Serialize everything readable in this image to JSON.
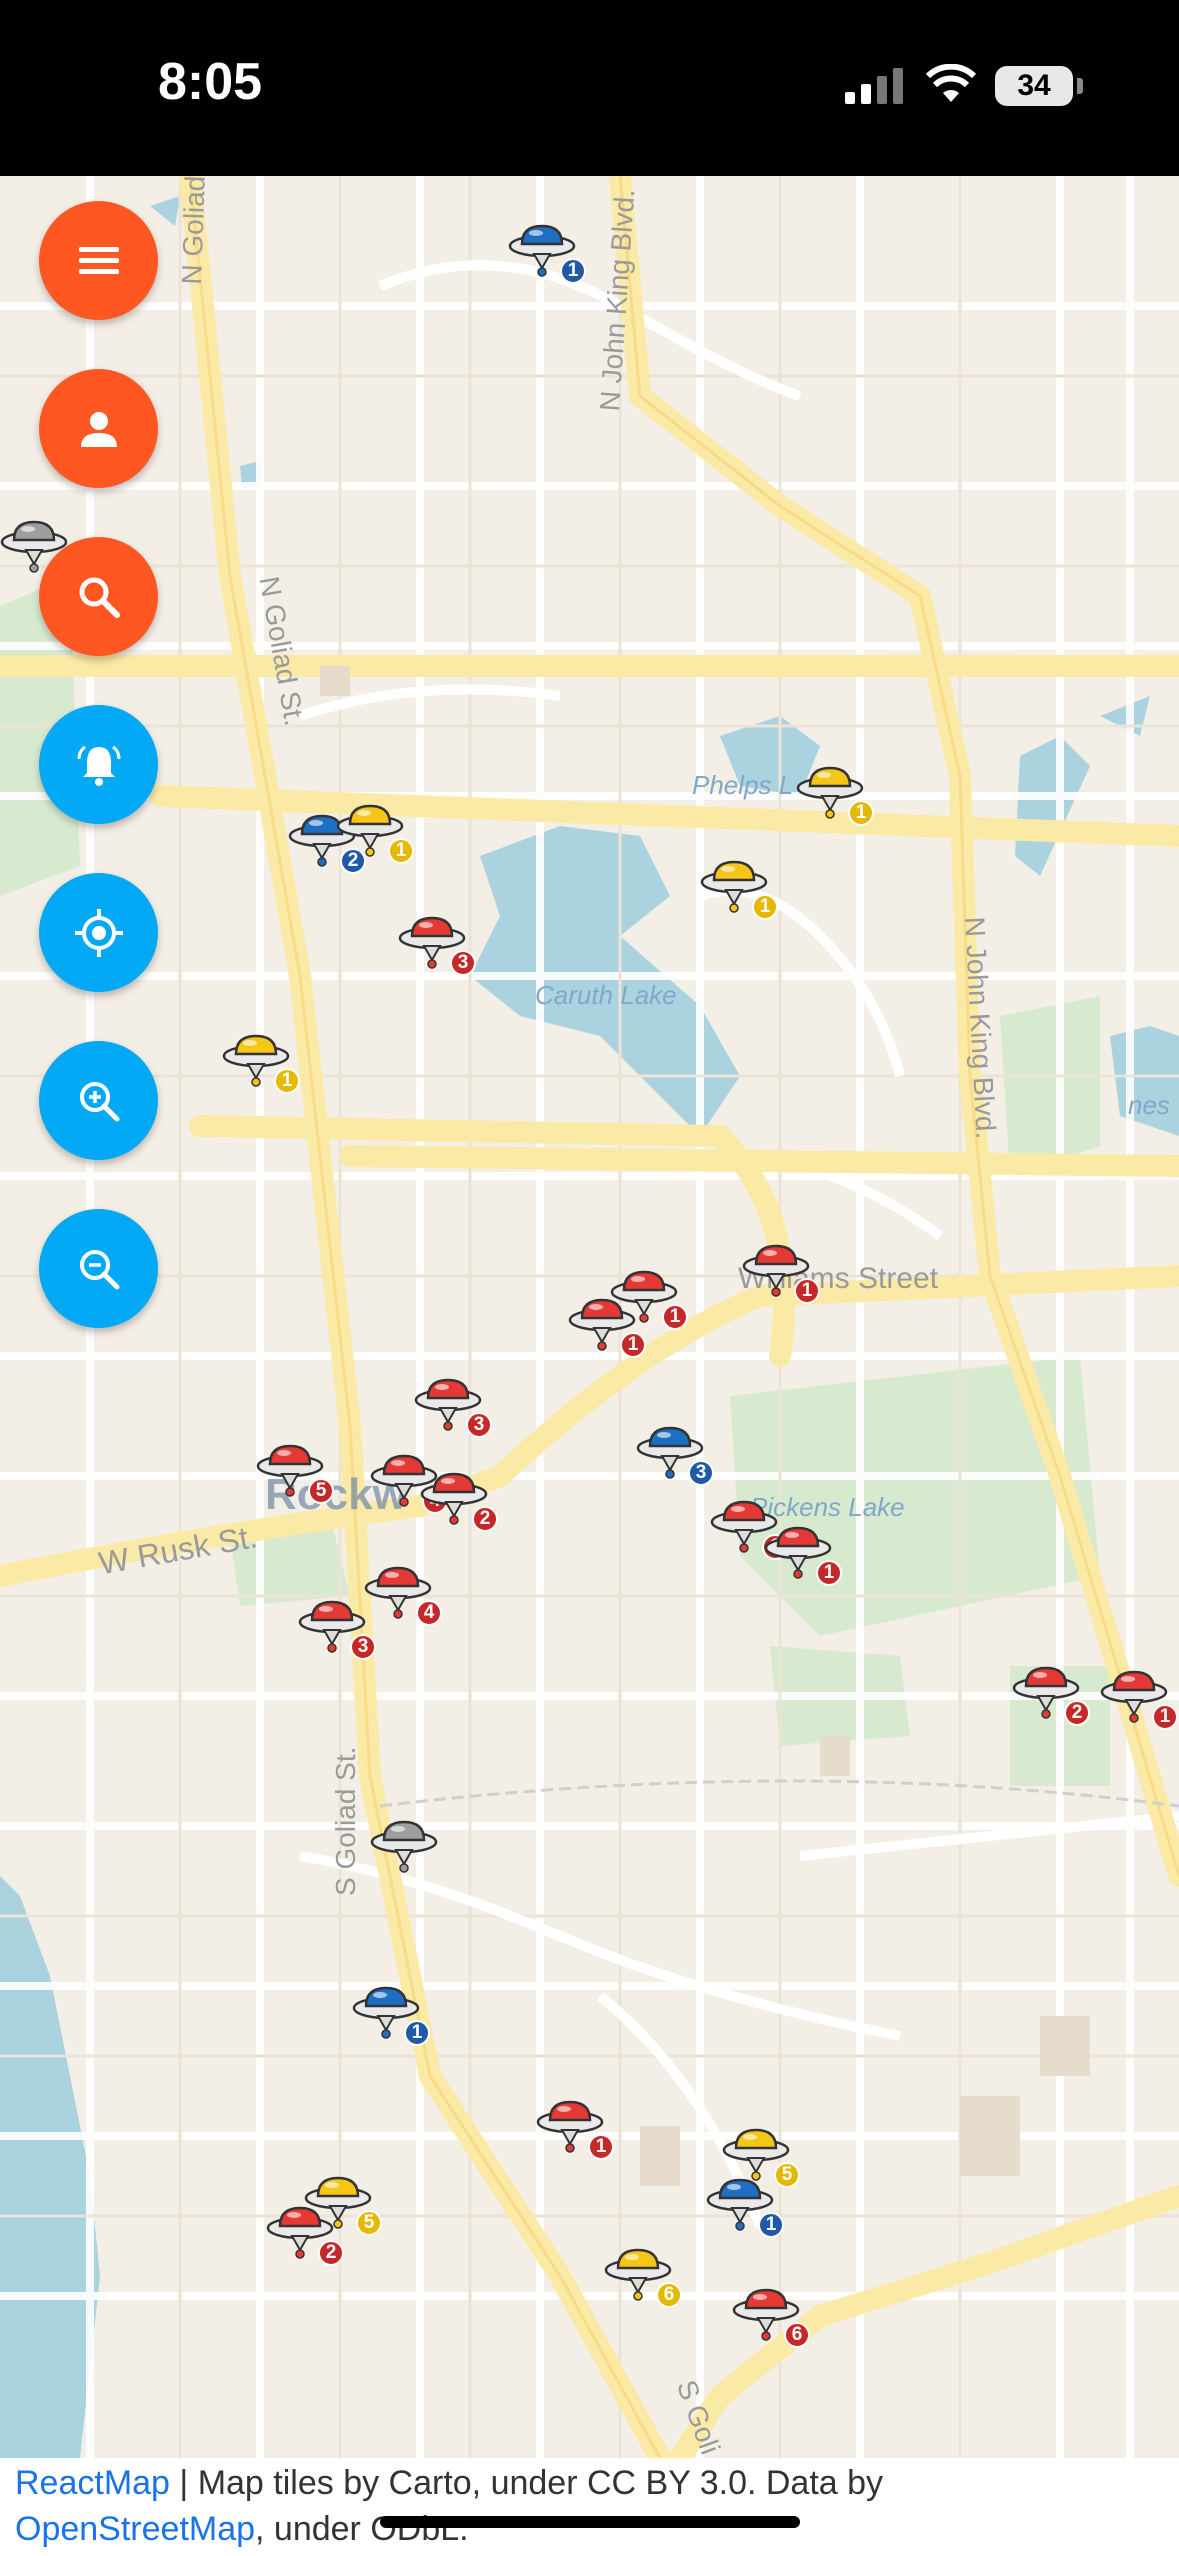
{
  "status_bar": {
    "time": "8:05",
    "battery": "34"
  },
  "map": {
    "streets": [
      "N Goliad St.",
      "N John King Blvd.",
      "N John King Blvd.",
      "N Goliad St.",
      "Williams Street",
      "W Rusk St.",
      "S Goliad St.",
      "S Goli"
    ],
    "water_labels": [
      "Phelps L",
      "Caruth Lake",
      "Pickens Lake",
      "nes"
    ],
    "town_label": "Rockw",
    "colors": {
      "red": "#e53935",
      "blue": "#1e6fc4",
      "yellow": "#f5c518",
      "gray": "#9e9e9e",
      "fab_orange": "#ff5722",
      "fab_blue": "#03a9f4",
      "water": "#aad3df",
      "park": "#d7ead0",
      "road": "#fbe9a6"
    },
    "pins": [
      {
        "color": "blue",
        "count": "1"
      },
      {
        "color": "gray",
        "count": ""
      },
      {
        "color": "yellow",
        "count": "1"
      },
      {
        "color": "blue",
        "count": "2"
      },
      {
        "color": "yellow",
        "count": "1"
      },
      {
        "color": "yellow",
        "count": "1"
      },
      {
        "color": "red",
        "count": "3"
      },
      {
        "color": "yellow",
        "count": "1"
      },
      {
        "color": "red",
        "count": "1"
      },
      {
        "color": "red",
        "count": "1"
      },
      {
        "color": "red",
        "count": "1"
      },
      {
        "color": "red",
        "count": "3"
      },
      {
        "color": "blue",
        "count": "3"
      },
      {
        "color": "red",
        "count": "5"
      },
      {
        "color": "red",
        "count": "4"
      },
      {
        "color": "red",
        "count": "2"
      },
      {
        "color": "red",
        "count": "1"
      },
      {
        "color": "red",
        "count": "1"
      },
      {
        "color": "red",
        "count": "4"
      },
      {
        "color": "red",
        "count": "3"
      },
      {
        "color": "red",
        "count": "2"
      },
      {
        "color": "red",
        "count": "1"
      },
      {
        "color": "gray",
        "count": ""
      },
      {
        "color": "blue",
        "count": "1"
      },
      {
        "color": "red",
        "count": "1"
      },
      {
        "color": "yellow",
        "count": "5"
      },
      {
        "color": "yellow",
        "count": "5"
      },
      {
        "color": "blue",
        "count": "1"
      },
      {
        "color": "red",
        "count": "2"
      },
      {
        "color": "yellow",
        "count": "6"
      },
      {
        "color": "red",
        "count": "6"
      }
    ]
  },
  "controls": {
    "menu_icon": "menu-icon",
    "profile_icon": "person-icon",
    "search_icon": "search-icon",
    "notifications_icon": "bell-icon",
    "locate_icon": "crosshair-icon",
    "zoom_in_icon": "zoom-in-icon",
    "zoom_out_icon": "zoom-out-icon"
  },
  "attribution": {
    "link1": "ReactMap",
    "text1": " | Map tiles by Carto, under CC BY 3.0. Data by",
    "link2": "OpenStreetMap",
    "text2": ", under ODbL."
  }
}
